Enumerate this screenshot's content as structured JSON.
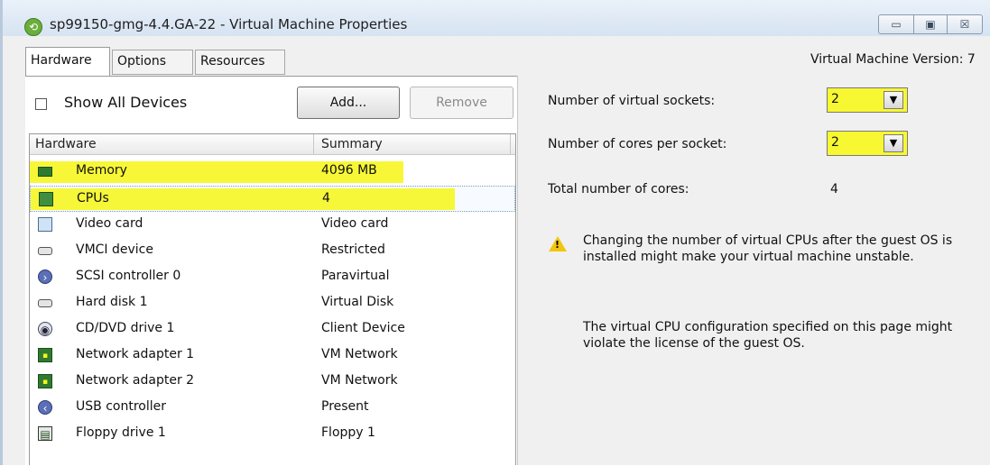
{
  "window": {
    "title": "sp99150-gmg-4.4.GA-22 - Virtual Machine Properties",
    "version_label": "Virtual Machine Version: 7",
    "controls": {
      "minimize": "▭",
      "maximize": "▣",
      "close": "☒"
    }
  },
  "tabs": [
    {
      "label": "Hardware",
      "selected": true
    },
    {
      "label": "Options",
      "selected": false
    },
    {
      "label": "Resources",
      "selected": false
    }
  ],
  "toolbar": {
    "show_all_label": "Show All Devices",
    "show_all_checked": false,
    "add_label": "Add...",
    "remove_label": "Remove"
  },
  "device_list": {
    "columns": [
      "Hardware",
      "Summary"
    ],
    "rows": [
      {
        "name": "Memory",
        "summary": "4096 MB",
        "icon": "memory-icon",
        "highlighted": true,
        "selected": false
      },
      {
        "name": "CPUs",
        "summary": "4",
        "icon": "cpu-icon",
        "highlighted": true,
        "selected": true
      },
      {
        "name": "Video card",
        "summary": "Video card",
        "icon": "monitor-icon",
        "highlighted": false,
        "selected": false
      },
      {
        "name": "VMCI device",
        "summary": "Restricted",
        "icon": "device-icon",
        "highlighted": false,
        "selected": false
      },
      {
        "name": "SCSI controller 0",
        "summary": "Paravirtual",
        "icon": "scsi-controller-icon",
        "highlighted": false,
        "selected": false
      },
      {
        "name": "Hard disk 1",
        "summary": "Virtual Disk",
        "icon": "hard-disk-icon",
        "highlighted": false,
        "selected": false
      },
      {
        "name": "CD/DVD drive 1",
        "summary": "Client Device",
        "icon": "cd-dvd-icon",
        "highlighted": false,
        "selected": false
      },
      {
        "name": "Network adapter 1",
        "summary": "VM Network",
        "icon": "network-adapter-icon",
        "highlighted": false,
        "selected": false
      },
      {
        "name": "Network adapter 2",
        "summary": "VM Network",
        "icon": "network-adapter-icon",
        "highlighted": false,
        "selected": false
      },
      {
        "name": "USB controller",
        "summary": "Present",
        "icon": "usb-controller-icon",
        "highlighted": false,
        "selected": false
      },
      {
        "name": "Floppy drive 1",
        "summary": "Floppy 1",
        "icon": "floppy-drive-icon",
        "highlighted": false,
        "selected": false
      }
    ]
  },
  "cpu_settings": {
    "sockets_label": "Number of virtual sockets:",
    "sockets_value": "2",
    "cores_label": "Number of cores per socket:",
    "cores_value": "2",
    "total_label": "Total number of cores:",
    "total_value": "4",
    "warning_text": "Changing the number of virtual CPUs after the guest OS is installed might make your virtual machine unstable.",
    "license_text": "The virtual CPU configuration specified on this page might violate the license of the guest OS."
  },
  "colors": {
    "highlight": "#f6f61c",
    "titlebar": "#d6e3f2",
    "warning": "#f2c60f"
  }
}
